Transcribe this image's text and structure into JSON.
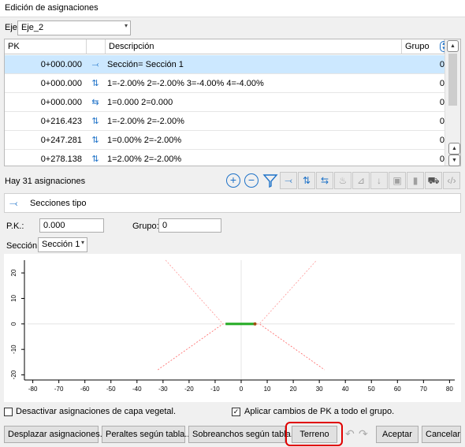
{
  "window": {
    "title": "Edición de asignaciones"
  },
  "eje": {
    "label": "Eje:",
    "value": "Eje_2"
  },
  "table": {
    "headers": {
      "pk": "PK",
      "icon": "",
      "descripcion": "Descripción",
      "grupo": "Grupo"
    },
    "rows": [
      {
        "pk": "0+000.000",
        "icon": "section-icon",
        "descripcion": "Sección= Sección 1",
        "grupo": "0",
        "selected": true
      },
      {
        "pk": "0+000.000",
        "icon": "superelevation-icon",
        "descripcion": "1=-2.00%   2=-2.00%   3=-4.00%   4=-4.00%",
        "grupo": "0"
      },
      {
        "pk": "0+000.000",
        "icon": "widening-icon",
        "descripcion": "1=0.000   2=0.000",
        "grupo": "0"
      },
      {
        "pk": "0+216.423",
        "icon": "superelevation-icon",
        "descripcion": "1=-2.00%   2=-2.00%",
        "grupo": "0"
      },
      {
        "pk": "0+247.281",
        "icon": "superelevation-icon",
        "descripcion": "1=0.00%   2=-2.00%",
        "grupo": "0"
      },
      {
        "pk": "0+278.138",
        "icon": "superelevation-icon",
        "descripcion": "1=2.00%   2=-2.00%",
        "grupo": "0"
      }
    ]
  },
  "count_text": "Hay 31 asignaciones",
  "panel": {
    "title": "Secciones tipo"
  },
  "form": {
    "pk_label": "P.K.:",
    "pk_value": "0.000",
    "grupo_label": "Grupo:",
    "grupo_value": "0",
    "seccion_label": "Sección:",
    "seccion_value": "Sección 1"
  },
  "chart_data": {
    "type": "line",
    "xlim": [
      -82,
      82
    ],
    "ylim": [
      -22,
      25
    ],
    "xticks": [
      "-80",
      "-70",
      "-60",
      "-50",
      "-40",
      "-30",
      "-20",
      "-10",
      "0",
      "10",
      "20",
      "30",
      "40",
      "50",
      "60",
      "70",
      "80"
    ],
    "yticks": [
      "20",
      "10",
      "0",
      "-10",
      "-20"
    ],
    "series": [
      {
        "color": "#ff6666",
        "values": [
          [
            -32,
            -18
          ],
          [
            -7,
            0
          ],
          [
            7,
            0
          ],
          [
            32,
            -18
          ]
        ]
      },
      {
        "color": "#ff9999",
        "values": [
          [
            -29,
            25
          ],
          [
            -7,
            0
          ],
          [
            7,
            0
          ],
          [
            29,
            25
          ]
        ]
      },
      {
        "color": "#22aa22",
        "values": [
          [
            -6,
            0
          ],
          [
            5,
            0
          ]
        ]
      }
    ]
  },
  "options": {
    "veg": "Desactivar asignaciones de capa vegetal.",
    "veg_checked": false,
    "apply": "Aplicar cambios de PK a todo el grupo.",
    "apply_checked": true
  },
  "buttons": {
    "desplazar": "Desplazar asignaciones...",
    "peraltes": "Peraltes según tabla...",
    "sobreanchos": "Sobreanchos según tabla...",
    "terreno": "Terreno",
    "aceptar": "Aceptar",
    "cancelar": "Cancelar"
  },
  "colors": {
    "accent": "#1e72c8",
    "selection": "#cce8ff",
    "highlight": "#e00000"
  }
}
